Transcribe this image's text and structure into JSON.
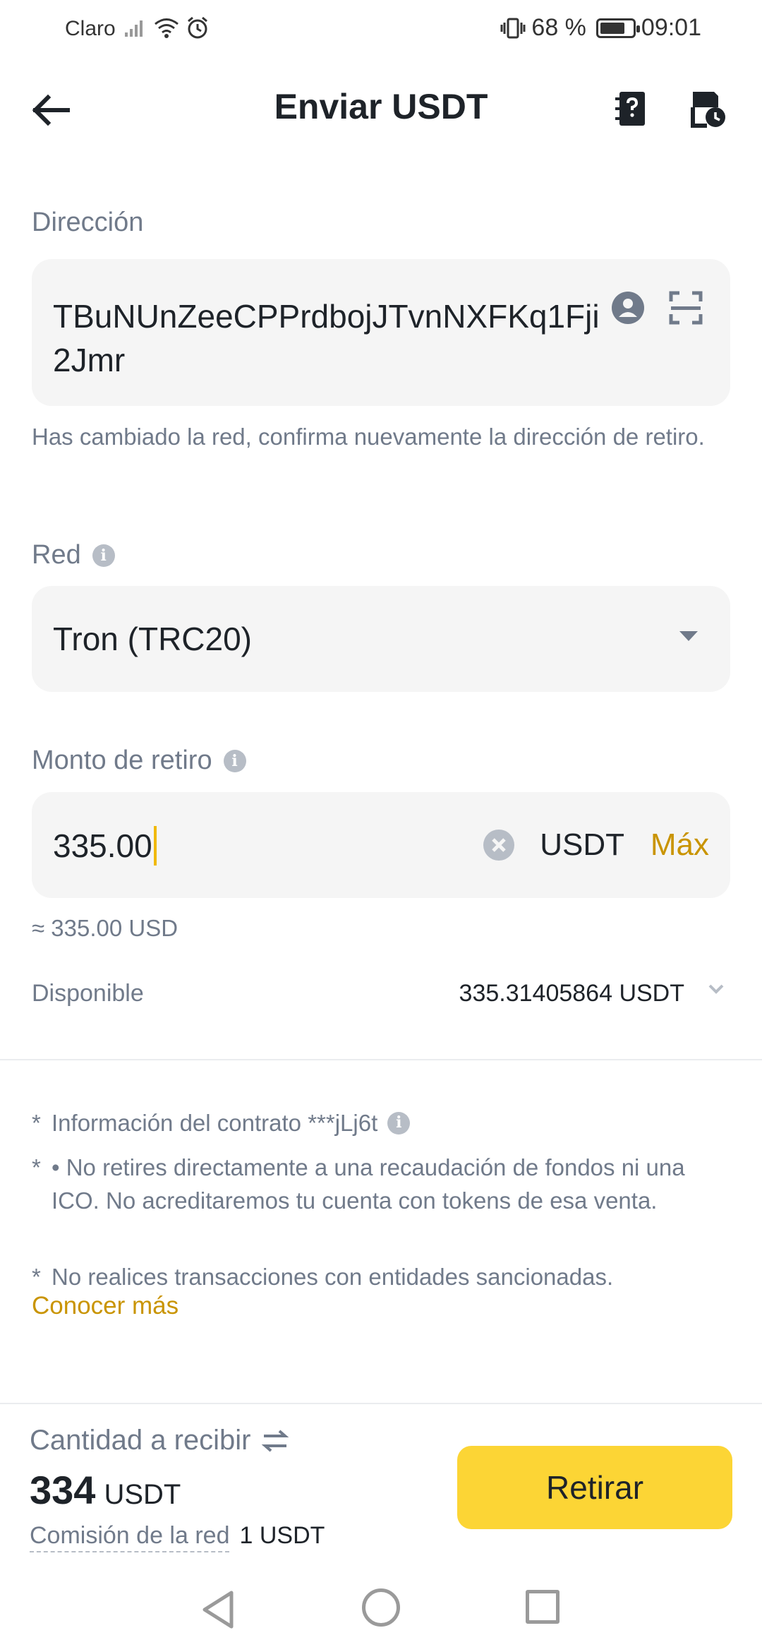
{
  "status_bar": {
    "carrier": "Claro",
    "battery_percent": "68 %",
    "time": "09:01"
  },
  "header": {
    "title": "Enviar USDT",
    "icons": [
      "back-arrow-icon",
      "address-book-help-icon",
      "history-icon"
    ]
  },
  "address": {
    "label": "Dirección",
    "value": "TBuNUnZeeCPPrdbojJTvnNXFKq1Fji2Jmr",
    "hint": "Has cambiado la red, confirma nuevamente la dirección de retiro."
  },
  "network": {
    "label": "Red",
    "selected": "Tron (TRC20)"
  },
  "amount": {
    "label": "Monto de retiro",
    "value": "335.00",
    "unit": "USDT",
    "max_label": "Máx",
    "approx": "≈ 335.00 USD"
  },
  "available": {
    "label": "Disponible",
    "value": "335.31405864 USDT"
  },
  "notes": {
    "contract": "Información del contrato ***jLj6t",
    "ico_warning": "• No retires directamente a una recaudación de fondos ni una ICO. No acreditaremos tu cuenta con tokens de esa venta.",
    "sanctions": "No realices transacciones con entidades sancionadas.",
    "learn_more": "Conocer más",
    "star": "*"
  },
  "receive": {
    "label": "Cantidad a recibir",
    "amount": "334",
    "unit": "USDT",
    "fee_label": "Comisión de la red",
    "fee_value": "1 USDT"
  },
  "action": {
    "withdraw_label": "Retirar"
  },
  "colors": {
    "accent": "#FCD535",
    "link": "#C99400",
    "muted": "#707A8A",
    "field_bg": "#F5F5F5"
  }
}
